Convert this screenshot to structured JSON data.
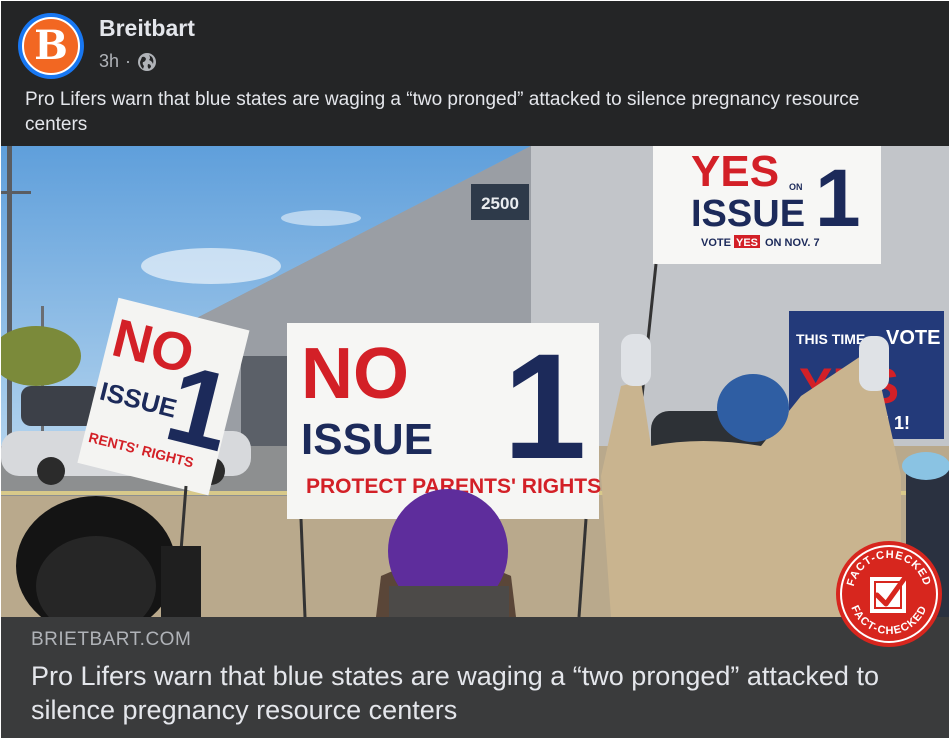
{
  "post": {
    "author": "Breitbart",
    "avatar_letter": "B",
    "time": "3h",
    "separator": "·",
    "audience_icon": "globe-icon",
    "text": "Pro Lifers warn that blue states are waging a “two pronged” attacked to silence pregnancy resource centers"
  },
  "image": {
    "building_number": "2500",
    "sign_left": {
      "top": "NO",
      "middle": "ISSUE",
      "number": "1",
      "bottom": "RENTS' RIGHTS"
    },
    "sign_center": {
      "top": "NO",
      "middle": "ISSUE",
      "number": "1",
      "bottom": "PROTECT PARENTS' RIGHTS"
    },
    "sign_top_right": {
      "top": "YES",
      "on": "ON",
      "middle": "ISSUE",
      "number": "1",
      "bottom_pre": "VOTE",
      "bottom_yes": "YES",
      "bottom_post": "ON NOV. 7"
    },
    "sign_right": {
      "top": "THIS TIME",
      "vote": "VOTE",
      "middle": "YES",
      "bottom": "ON ISSUE 1!"
    }
  },
  "link": {
    "domain": "BRIETBART.COM",
    "title": "Pro Lifers warn that blue states are waging a “two pronged” attacked to silence pregnancy resource centers"
  },
  "badge": {
    "text_top": "FACT-CHECKED",
    "text_bottom": "FACT-CHECKED",
    "icon": "checkbox-check-icon",
    "color": "#d7261e"
  },
  "colors": {
    "background": "#242526",
    "link_footer": "#3a3b3c",
    "avatar_ring": "#1877f2",
    "brand_orange": "#f26722",
    "sign_red": "#d32027",
    "sign_navy": "#1c2a5a"
  }
}
